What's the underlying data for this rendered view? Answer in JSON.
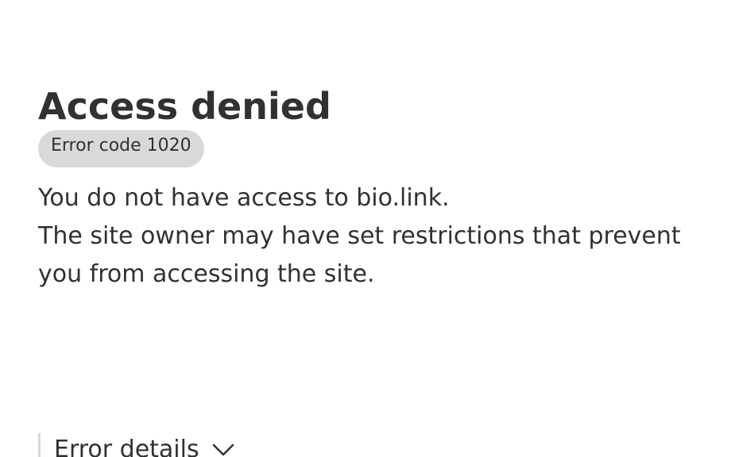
{
  "heading": "Access denied",
  "error_code": "Error code 1020",
  "message": {
    "line1": "You do not have access to bio.link.",
    "line2": "The site owner may have set restrictions that prevent you from accessing the site."
  },
  "details": {
    "label": "Error details",
    "icon": "chevron-down-icon"
  },
  "colors": {
    "text": "#313131",
    "badge_bg": "#d9d9d9",
    "background": "#ffffff"
  }
}
